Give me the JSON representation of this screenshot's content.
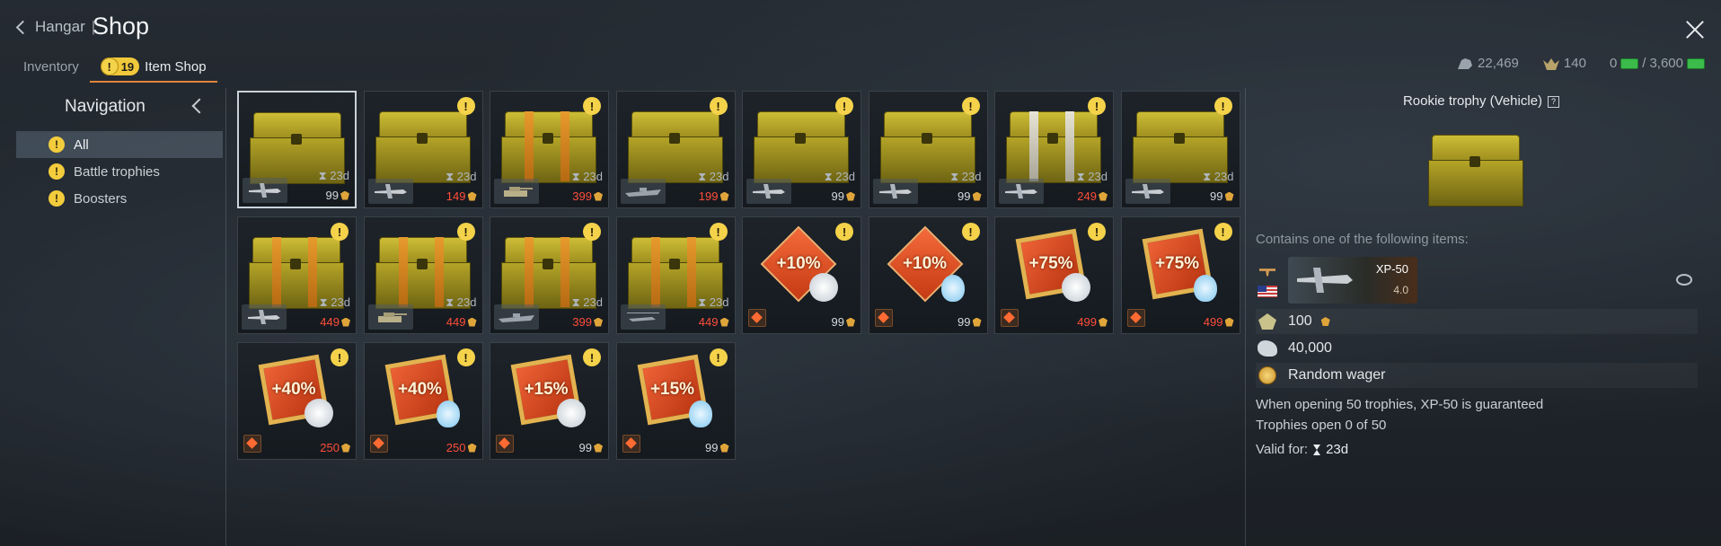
{
  "header": {
    "back_label": "Hangar",
    "separator": "|",
    "title": "Shop"
  },
  "tabs": [
    {
      "label": "Inventory"
    },
    {
      "label": "Item Shop",
      "badge": "19"
    }
  ],
  "currency": {
    "silver": "22,469",
    "gold": "140",
    "money_current": "0",
    "money_separator": "/",
    "money_total": "3,600"
  },
  "navigation": {
    "title": "Navigation",
    "items": [
      {
        "label": "All",
        "warn": "!"
      },
      {
        "label": "Battle trophies",
        "warn": "!"
      },
      {
        "label": "Boosters",
        "warn": "!"
      }
    ]
  },
  "cards": [
    {
      "type": "chest",
      "time": "23d",
      "price": "99",
      "red": false,
      "vehicle": "plane"
    },
    {
      "type": "chest",
      "time": "23d",
      "price": "149",
      "red": true,
      "vehicle": "plane"
    },
    {
      "type": "chest",
      "time": "23d",
      "price": "399",
      "red": true,
      "vehicle": "tank"
    },
    {
      "type": "chest",
      "time": "23d",
      "price": "199",
      "red": true,
      "vehicle": "ship"
    },
    {
      "type": "chest",
      "time": "23d",
      "price": "99",
      "red": false,
      "vehicle": "plane"
    },
    {
      "type": "chest",
      "time": "23d",
      "price": "99",
      "red": false,
      "vehicle": "plane"
    },
    {
      "type": "chest",
      "time": "23d",
      "price": "249",
      "red": true,
      "vehicle": "plane"
    },
    {
      "type": "chest",
      "time": "23d",
      "price": "99",
      "red": false,
      "vehicle": "plane"
    },
    {
      "type": "chest",
      "time": "23d",
      "price": "449",
      "red": true,
      "vehicle": "plane"
    },
    {
      "type": "chest",
      "time": "23d",
      "price": "449",
      "red": true,
      "vehicle": "tank"
    },
    {
      "type": "chest",
      "time": "23d",
      "price": "399",
      "red": true,
      "vehicle": "ship"
    },
    {
      "type": "chest",
      "time": "23d",
      "price": "449",
      "red": true,
      "vehicle": "helicopter"
    },
    {
      "type": "booster",
      "percent": "+10%",
      "price": "99",
      "red": false,
      "emblem": "lion"
    },
    {
      "type": "booster",
      "percent": "+10%",
      "price": "99",
      "red": false,
      "emblem": "bulb"
    },
    {
      "type": "booster",
      "percent": "+75%",
      "price": "499",
      "red": true,
      "emblem": "lion"
    },
    {
      "type": "booster",
      "percent": "+75%",
      "price": "499",
      "red": true,
      "emblem": "bulb"
    },
    {
      "type": "booster",
      "percent": "+40%",
      "price": "250",
      "red": true,
      "emblem": "lion"
    },
    {
      "type": "booster",
      "percent": "+40%",
      "price": "250",
      "red": true,
      "emblem": "bulb"
    },
    {
      "type": "booster",
      "percent": "+15%",
      "price": "99",
      "red": false,
      "emblem": "lion"
    },
    {
      "type": "booster",
      "percent": "+15%",
      "price": "99",
      "red": false,
      "emblem": "bulb"
    }
  ],
  "detail": {
    "title": "Rookie trophy (Vehicle)",
    "help": "?",
    "contains_label": "Contains one of the following items:",
    "vehicle_name": "XP-50",
    "vehicle_br": "4.0",
    "rewards": [
      {
        "label": "100"
      },
      {
        "label": "40,000"
      },
      {
        "label": "Random wager"
      }
    ],
    "guarantee_text": "When opening 50 trophies, XP-50 is guaranteed",
    "progress_text": "Trophies open 0 of 50",
    "valid_label": "Valid for:",
    "valid_value": "23d"
  }
}
